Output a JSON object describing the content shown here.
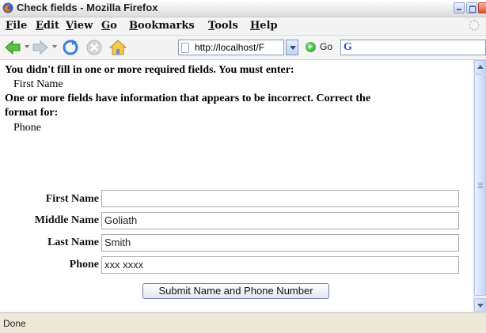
{
  "window": {
    "title": "Check fields - Mozilla Firefox"
  },
  "menu": [
    {
      "acc": "F",
      "rest": "ile"
    },
    {
      "acc": "E",
      "rest": "dit"
    },
    {
      "acc": "V",
      "rest": "iew"
    },
    {
      "acc": "G",
      "rest": "o"
    },
    {
      "acc": "B",
      "rest": "ookmarks"
    },
    {
      "acc": "T",
      "rest": "ools"
    },
    {
      "acc": "H",
      "rest": "elp"
    }
  ],
  "toolbar": {
    "url": "http://localhost/F",
    "go_label": "Go",
    "search_logo": "G"
  },
  "content": {
    "missing_message": "You didn't fill in one or more required fields. You must enter:",
    "missing_field": "First Name",
    "incorrect_message_line1": "One or more fields have information that appears to be incorrect. Correct the",
    "incorrect_message_line2": "format for:",
    "incorrect_field": "Phone"
  },
  "form": {
    "fields": [
      {
        "label": "First Name",
        "value": ""
      },
      {
        "label": "Middle Name",
        "value": "Goliath"
      },
      {
        "label": "Last Name",
        "value": "Smith"
      },
      {
        "label": "Phone",
        "value": "xxx xxxx"
      }
    ],
    "submit_label": "Submit Name and Phone Number"
  },
  "status": {
    "text": "Done"
  },
  "colors": {
    "accent": "#7f9db9",
    "go_green": "#1f9b1f"
  }
}
